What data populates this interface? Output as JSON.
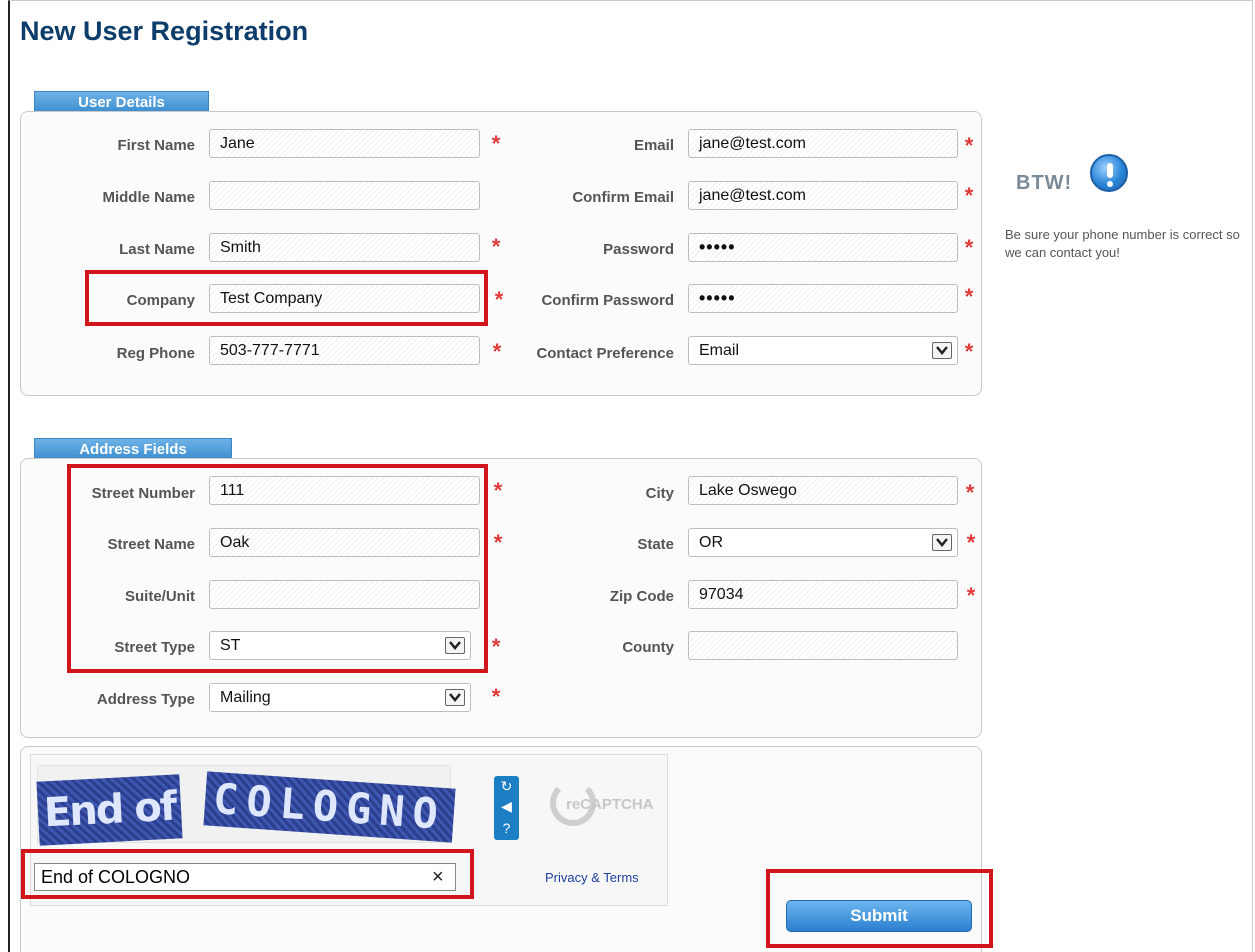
{
  "page_title": "New User Registration",
  "user_details": {
    "tab_label": "User Details",
    "first_name": {
      "label": "First Name",
      "value": "Jane"
    },
    "middle_name": {
      "label": "Middle Name",
      "value": ""
    },
    "last_name": {
      "label": "Last Name",
      "value": "Smith"
    },
    "company": {
      "label": "Company",
      "value": "Test Company"
    },
    "reg_phone": {
      "label": "Reg Phone",
      "value": "503-777-7771"
    },
    "email": {
      "label": "Email",
      "value": "jane@test.com"
    },
    "confirm_email": {
      "label": "Confirm Email",
      "value": "jane@test.com"
    },
    "password": {
      "label": "Password",
      "value": "•••••"
    },
    "confirm_password": {
      "label": "Confirm Password",
      "value": "•••••"
    },
    "contact_preference": {
      "label": "Contact Preference",
      "value": "Email"
    }
  },
  "btw": {
    "title": "BTW!",
    "text": "Be sure your phone number is correct so we can contact you!",
    "icon": "info-icon"
  },
  "address": {
    "tab_label": "Address Fields",
    "street_number": {
      "label": "Street Number",
      "value": "111"
    },
    "street_name": {
      "label": "Street Name",
      "value": "Oak"
    },
    "suite_unit": {
      "label": "Suite/Unit",
      "value": ""
    },
    "street_type": {
      "label": "Street Type",
      "value": "ST"
    },
    "address_type": {
      "label": "Address Type",
      "value": "Mailing"
    },
    "city": {
      "label": "City",
      "value": "Lake Oswego"
    },
    "state": {
      "label": "State",
      "value": "OR"
    },
    "zip_code": {
      "label": "Zip Code",
      "value": "97034"
    },
    "county": {
      "label": "County",
      "value": ""
    }
  },
  "captcha": {
    "word1": "End of",
    "word2": "COLOGNO",
    "input_value": "End of COLOGNO",
    "clear": "×",
    "brand": "reCAPTCHA",
    "privacy": "Privacy & Terms"
  },
  "required_mark": "*",
  "submit_label": "Submit",
  "colors": {
    "title": "#0d3d6b",
    "tab": "#3c8fd2",
    "required": "#e03a3a",
    "highlight": "#d0161c"
  }
}
